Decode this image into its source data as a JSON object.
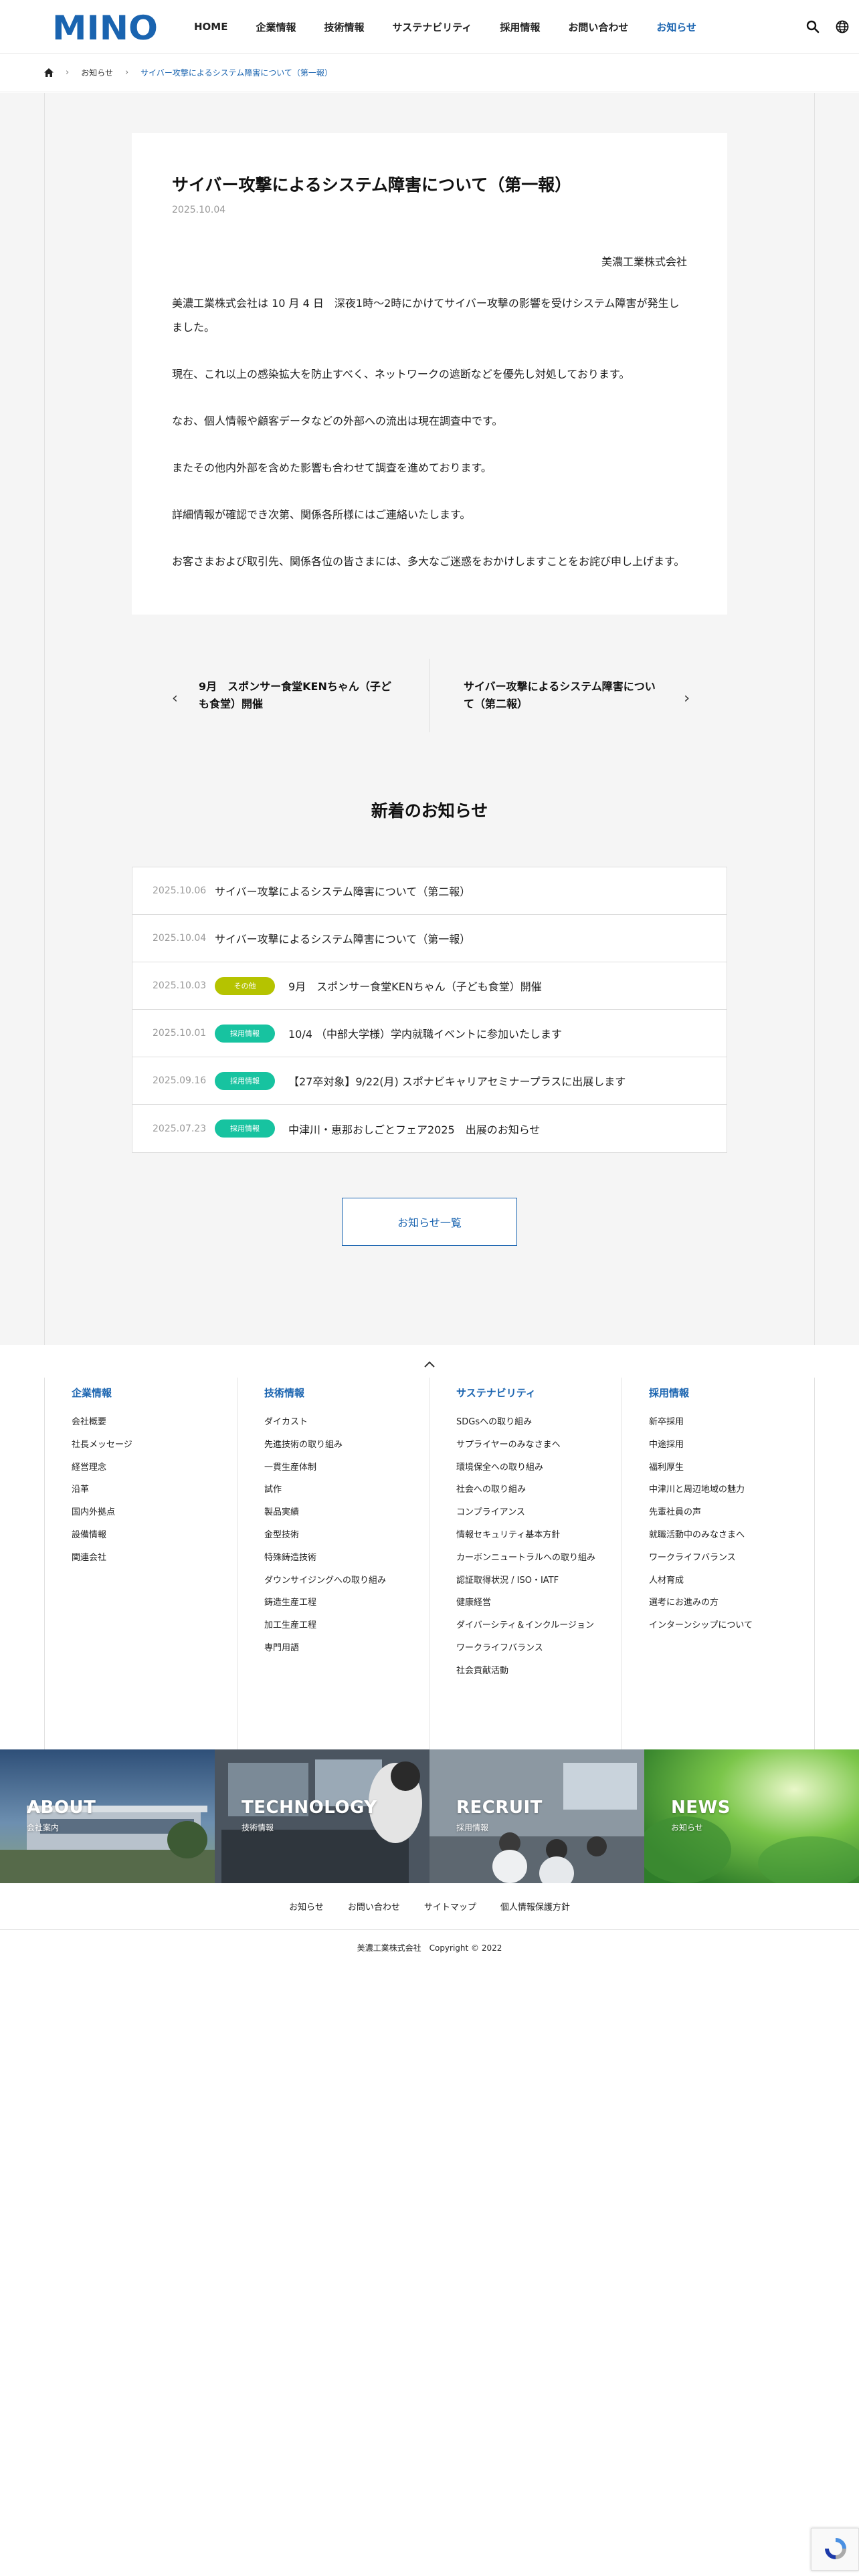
{
  "header": {
    "logo_text": "MINO",
    "nav": [
      {
        "label": "HOME"
      },
      {
        "label": "企業情報"
      },
      {
        "label": "技術情報"
      },
      {
        "label": "サステナビリティ"
      },
      {
        "label": "採用情報"
      },
      {
        "label": "お問い合わせ"
      },
      {
        "label": "お知らせ"
      }
    ],
    "search_icon": "search-icon",
    "language_icon": "globe-icon",
    "accent_color": "#1a64b0"
  },
  "breadcrumb": {
    "home_icon": "home-icon",
    "items": [
      "お知らせ",
      "サイバー攻撃によるシステム障害について（第一報）"
    ]
  },
  "article": {
    "title": "サイバー攻撃によるシステム障害について（第一報）",
    "date": "2025.10.04",
    "company": "美濃工業株式会社",
    "paragraphs": [
      "美濃工業株式会社は 10 月 4 日　深夜1時〜2時にかけてサイバー攻撃の影響を受けシステム障害が発生しました。",
      "現在、これ以上の感染拡大を防止すべく、ネットワークの遮断などを優先し対処しております。",
      "なお、個人情報や顧客データなどの外部への流出は現在調査中です。",
      "またその他内外部を含めた影響も合わせて調査を進めております。",
      "詳細情報が確認でき次第、関係各所様にはご連絡いたします。",
      "お客さまおよび取引先、関係各位の皆さまには、多大なご迷惑をおかけしますことをお詫び申し上げます。"
    ]
  },
  "pager": {
    "prev": "9月　スポンサー食堂KENちゃん（子ども食堂）開催",
    "next": "サイバー攻撃によるシステム障害について（第二報）"
  },
  "latest": {
    "heading": "新着のお知らせ",
    "items": [
      {
        "date": "2025.10.06",
        "category": "",
        "title": "サイバー攻撃によるシステム障害について（第二報）"
      },
      {
        "date": "2025.10.04",
        "category": "",
        "title": "サイバー攻撃によるシステム障害について（第一報）"
      },
      {
        "date": "2025.10.03",
        "category": "その他",
        "color": "#b5c300",
        "title": "9月　スポンサー食堂KENちゃん（子ども食堂）開催"
      },
      {
        "date": "2025.10.01",
        "category": "採用情報",
        "color": "#17c3a0",
        "title": "10/4 （中部大学様）学内就職イベントに参加いたします"
      },
      {
        "date": "2025.09.16",
        "category": "採用情報",
        "color": "#17c3a0",
        "title": "【27卒対象】9/22(月) スポナビキャリアセミナープラスに出展します"
      },
      {
        "date": "2025.07.23",
        "category": "採用情報",
        "color": "#17c3a0",
        "title": "中津川・恵那おしごとフェア2025　出展のお知らせ"
      }
    ],
    "more_label": "お知らせ一覧"
  },
  "footer": {
    "pagetop_icon": "chevron-up-icon",
    "columns": [
      {
        "title": "企業情報",
        "links": [
          "会社概要",
          "社長メッセージ",
          "経営理念",
          "沿革",
          "国内外拠点",
          "設備情報",
          "関連会社"
        ]
      },
      {
        "title": "技術情報",
        "links": [
          "ダイカスト",
          "先進技術の取り組み",
          "一貫生産体制",
          "試作",
          "製品実績",
          "金型技術",
          "特殊鋳造技術",
          "ダウンサイジングへの取り組み",
          "鋳造生産工程",
          "加工生産工程",
          "専門用語"
        ]
      },
      {
        "title": "サステナビリティ",
        "links": [
          "SDGsへの取り組み",
          "サプライヤーのみなさまへ",
          "環境保全への取り組み",
          "社会への取り組み",
          "コンプライアンス",
          "情報セキュリティ基本方針",
          "カーボンニュートラルへの取り組み",
          "認証取得状況 / ISO・IATF",
          "健康経営",
          "ダイバーシティ＆インクルージョン",
          "ワークライフバランス",
          "社会貢献活動"
        ]
      },
      {
        "title": "採用情報",
        "links": [
          "新卒採用",
          "中途採用",
          "福利厚生",
          "中津川と周辺地域の魅力",
          "先輩社員の声",
          "就職活動中のみなさまへ",
          "ワークライフバランス",
          "人材育成",
          "選考にお進みの方",
          "インターンシップについて"
        ]
      }
    ],
    "banners": [
      {
        "title": "ABOUT",
        "sub": "会社案内"
      },
      {
        "title": "TECHNOLOGY",
        "sub": "技術情報"
      },
      {
        "title": "RECRUIT",
        "sub": "採用情報"
      },
      {
        "title": "NEWS",
        "sub": "お知らせ"
      }
    ],
    "bottom_links": [
      "お知らせ",
      "お問い合わせ",
      "サイトマップ",
      "個人情報保護方針"
    ],
    "copyright": "美濃工業株式会社　Copyright © 2022"
  }
}
